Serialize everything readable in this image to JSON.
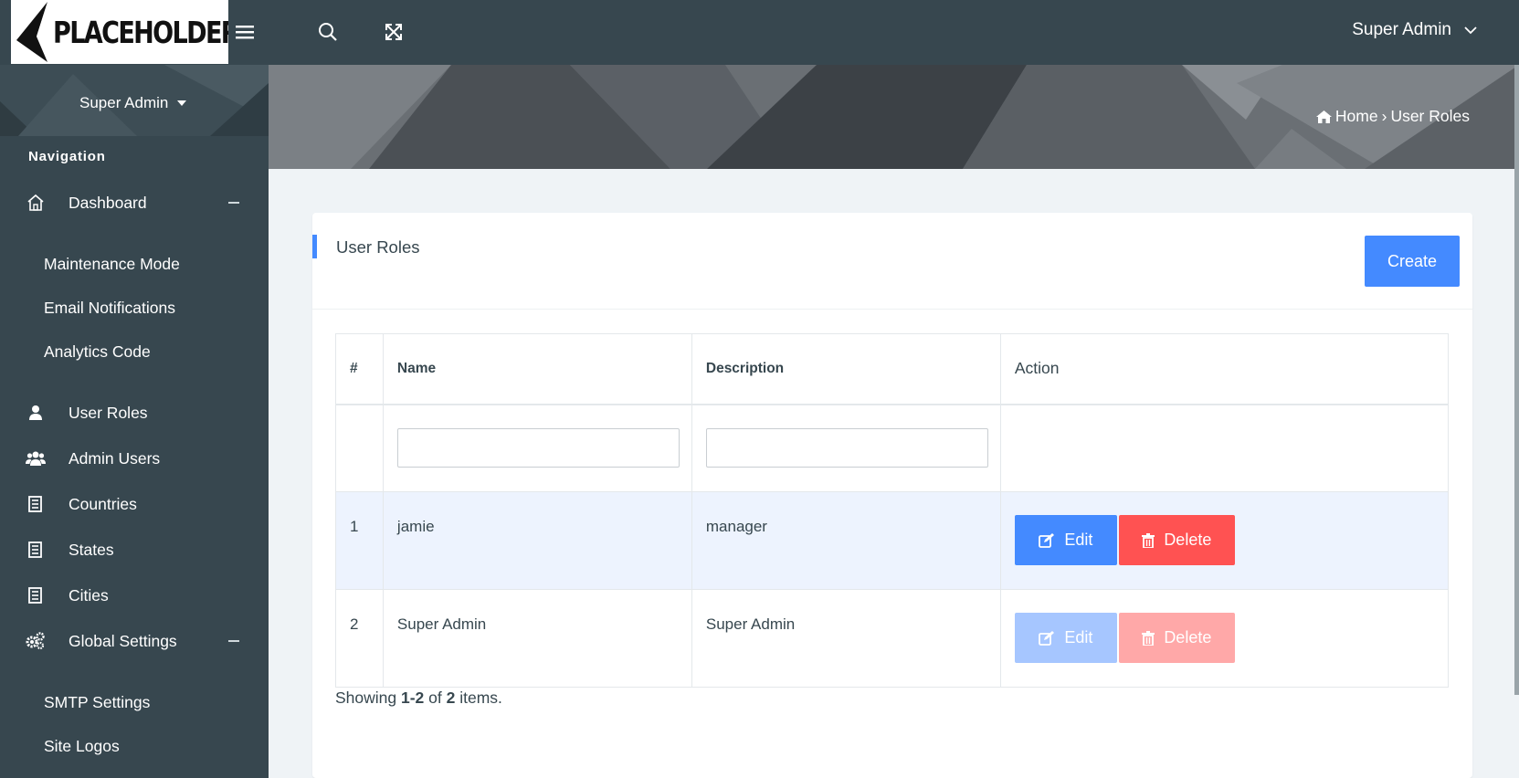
{
  "logo": {
    "text": "PLACEHOLDER"
  },
  "topbar": {
    "icons": [
      "menu-icon",
      "search-icon",
      "fullscreen-icon"
    ],
    "user_label": "Super Admin"
  },
  "sidebar": {
    "profile_name": "Super Admin",
    "nav_title": "Navigation",
    "items": [
      {
        "label": "Dashboard",
        "icon": "home-icon"
      },
      {
        "label": "Maintenance Mode"
      },
      {
        "label": "Email Notifications"
      },
      {
        "label": "Analytics Code"
      },
      {
        "label": "User Roles",
        "icon": "user-icon"
      },
      {
        "label": "Admin Users",
        "icon": "users-icon"
      },
      {
        "label": "Countries",
        "icon": "list-icon"
      },
      {
        "label": "States",
        "icon": "list-icon"
      },
      {
        "label": "Cities",
        "icon": "list-icon"
      },
      {
        "label": "Global Settings",
        "icon": "cogs-icon"
      },
      {
        "label": "SMTP Settings"
      },
      {
        "label": "Site Logos"
      }
    ]
  },
  "breadcrumb": {
    "home": "Home",
    "separator": "›",
    "current": "User Roles"
  },
  "card": {
    "title": "User Roles",
    "create_label": "Create"
  },
  "table": {
    "headers": [
      "#",
      "Name",
      "Description",
      "Action"
    ],
    "rows": [
      {
        "num": "1",
        "name": "jamie",
        "description": "manager",
        "edit": "Edit",
        "delete": "Delete"
      },
      {
        "num": "2",
        "name": "Super Admin",
        "description": "Super Admin",
        "edit": "Edit",
        "delete": "Delete"
      }
    ]
  },
  "summary": {
    "prefix": "Showing ",
    "range": "1-2",
    "middle": " of ",
    "total": "2",
    "suffix": " items."
  },
  "colors": {
    "topbar": "#37474f",
    "primary": "#448aff",
    "danger": "#ff5252",
    "row_highlight": "#edf3fe"
  }
}
